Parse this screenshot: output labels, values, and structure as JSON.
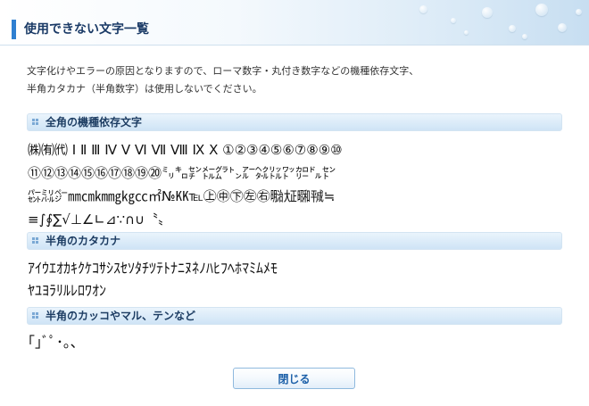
{
  "page": {
    "title": "使用できない文字一覧"
  },
  "intro": {
    "line1": "文字化けやエラーの原因となりますので、ローマ数字・丸付き数字などの機種依存文字、",
    "line2": "半角カタカナ（半角数字）は使用しないでください。"
  },
  "sections": [
    {
      "heading": "全角の機種依存文字",
      "lines": [
        "㈱㈲㈹ Ⅰ Ⅱ Ⅲ Ⅳ Ⅴ Ⅵ Ⅶ Ⅷ Ⅸ Ⅹ ①②③④⑤⑥⑦⑧⑨⑩",
        "⑪⑫⑬⑭⑮⑯⑰⑱⑲⑳㍉㌔㌢㍍㌘㌧㌃㌶㍑㍗㌍㌦㌣",
        "㌫㍊㌻㎜㎝㎞㎎㎏㏄㎡№㏍℡㊤㊥㊦㊧㊨㍾㍽㍼㍻≒",
        "≡∫∮∑√⊥∠∟⊿∵∩∪〝〟"
      ]
    },
    {
      "heading": "半角のカタカナ",
      "lines": [
        "ｱｲｳｴｵｶｷｸｹｺｻｼｽｾｿﾀﾁﾂﾃﾄﾅﾆﾇﾈﾉﾊﾋﾌﾍﾎﾏﾐﾑﾒﾓ",
        "ﾔﾕﾖﾗﾘﾙﾚﾛﾜｵﾝ"
      ]
    },
    {
      "heading": "半角のカッコやマル、テンなど",
      "lines": [
        "｢｣ﾞﾟ･｡､"
      ]
    }
  ],
  "buttons": {
    "close_label": "閉じる"
  },
  "colors": {
    "accent": "#2f7fd1",
    "section_bg": "#cfe4f6",
    "button_text": "#1b5fa8"
  },
  "icons": {
    "title_marker": "vertical-bar-icon",
    "section_marker": "dot-grid-icon"
  }
}
